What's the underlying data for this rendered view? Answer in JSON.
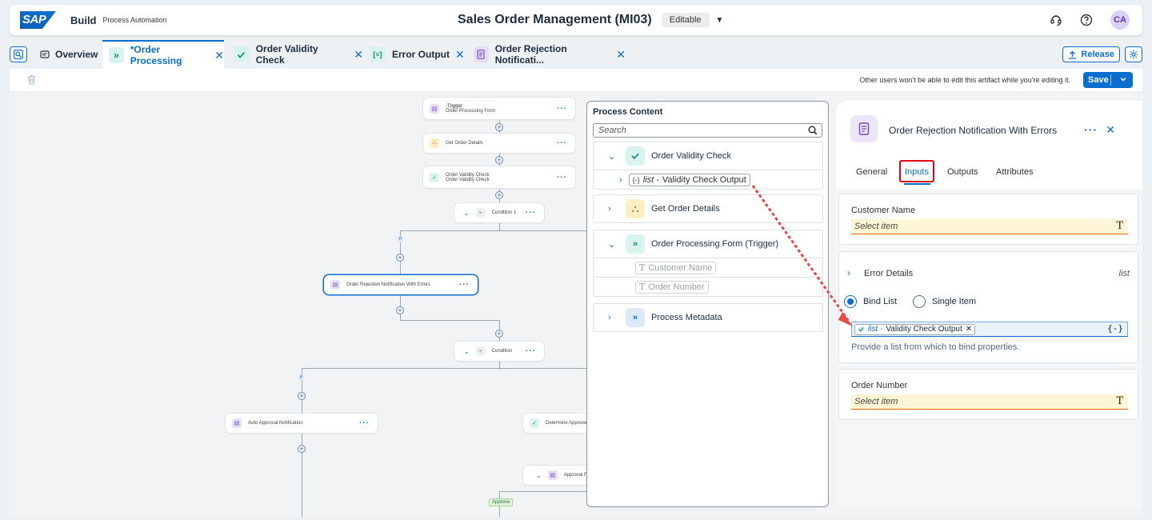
{
  "header": {
    "logo": "SAP",
    "product": "Build",
    "product_sub": "Process Automation",
    "title": "Sales Order Management (MI03)",
    "mode": "Editable",
    "avatar_initials": "CA",
    "icons": [
      "headset-icon",
      "help-icon"
    ]
  },
  "tabs": [
    {
      "label": "Overview",
      "closable": false
    },
    {
      "label": "*Order Processing",
      "closable": true,
      "active": true
    },
    {
      "label": "Order Validity Check",
      "closable": true
    },
    {
      "label": "Error Output",
      "closable": true
    },
    {
      "label": "Order Rejection Notificati...",
      "closable": true
    }
  ],
  "tabbar": {
    "release_label": "Release"
  },
  "toolbar": {
    "lock_note": "Other users won't be able to edit this artifact while you're editing it.",
    "save_label": "Save"
  },
  "canvas": {
    "nodes": {
      "trigger_tag": "Trigger",
      "trigger_label": "Order Processing Form",
      "get_order": "Get Order Details",
      "validity_title": "Order Validity Check",
      "validity_sub": "Order Validity Check",
      "condition1": "Condition 1",
      "rejection": "Order Rejection Notification With Errors",
      "condition": "Condition",
      "auto_approval": "Auto Approval Notification",
      "determine": "Determine Approver",
      "approval_form": "Approval Fo",
      "if1": "If",
      "if2": "If",
      "approve": "Approve"
    }
  },
  "process_content": {
    "title": "Process Content",
    "search_placeholder": "Search",
    "groups": [
      {
        "label": "Order Validity Check",
        "expanded": true,
        "children": [
          {
            "prefix": "list -",
            "label": "Validity Check Output"
          }
        ]
      },
      {
        "label": "Get Order Details",
        "expanded": false
      },
      {
        "label": "Order Processing Form (Trigger)",
        "expanded": true,
        "children": [
          {
            "label": "Customer Name"
          },
          {
            "label": "Order Number"
          }
        ]
      },
      {
        "label": "Process Metadata",
        "expanded": false
      }
    ]
  },
  "panel": {
    "title": "Order Rejection Notification With Errors",
    "tabs": [
      "General",
      "Inputs",
      "Outputs",
      "Attributes"
    ],
    "active_tab": "Inputs",
    "customer_name_label": "Customer Name",
    "select_placeholder": "Select item",
    "error_details_label": "Error Details",
    "error_details_type": "list",
    "bind_list_label": "Bind List",
    "single_item_label": "Single Item",
    "bind_token_prefix": "list -",
    "bind_token_label": "Validity Check Output",
    "bind_brace": "{-}",
    "bind_hint": "Provide a list from which to bind properties.",
    "order_number_label": "Order Number",
    "text_type_glyph": "T"
  },
  "colors": {
    "accent": "#0a6ed1",
    "highlight_red": "#e3001b",
    "arrow_red": "#e84a4a"
  }
}
